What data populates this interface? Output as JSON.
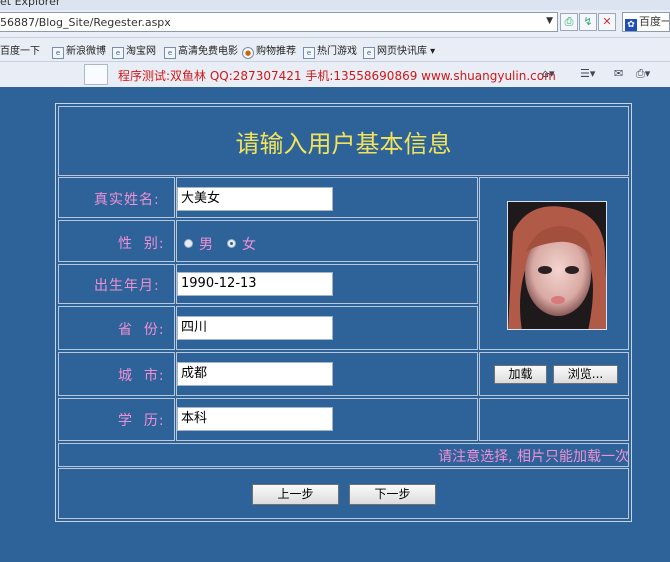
{
  "browser": {
    "window_title": "et Explorer",
    "address": "56887/Blog_Site/Regester.aspx",
    "search_text": "百度一",
    "favorites": [
      "百度一下",
      "新浪微博",
      "淘宝网",
      "高清免费电影",
      "购物推荐",
      "热门游戏",
      "网页快讯库"
    ],
    "scroll_message": "程序测试:双鱼林 QQ:287307421 手机:13558690869 www.shuangyulin.com"
  },
  "form": {
    "title": "请输入用户基本信息",
    "fields": {
      "name": {
        "label": "真实姓名:",
        "value": "大美女"
      },
      "gender": {
        "label": "性  别:",
        "options": [
          "男",
          "女"
        ],
        "selected": "女"
      },
      "birthdate": {
        "label": "出生年月:",
        "value": "1990-12-13"
      },
      "province": {
        "label": "省  份:",
        "value": "四川"
      },
      "city": {
        "label": "城  市:",
        "value": "成都"
      },
      "education": {
        "label": "学  历:",
        "value": "本科"
      }
    },
    "photo_buttons": {
      "load": "加载",
      "browse": "浏览..."
    },
    "notice": "请注意选择, 相片只能加载一次",
    "nav_buttons": {
      "prev": "上一步",
      "next": "下一步"
    }
  },
  "colors": {
    "page_background": "#2d6399",
    "title_color": "#f3e35a",
    "label_color": "#f08fd5",
    "marquee_color": "#d01818"
  }
}
